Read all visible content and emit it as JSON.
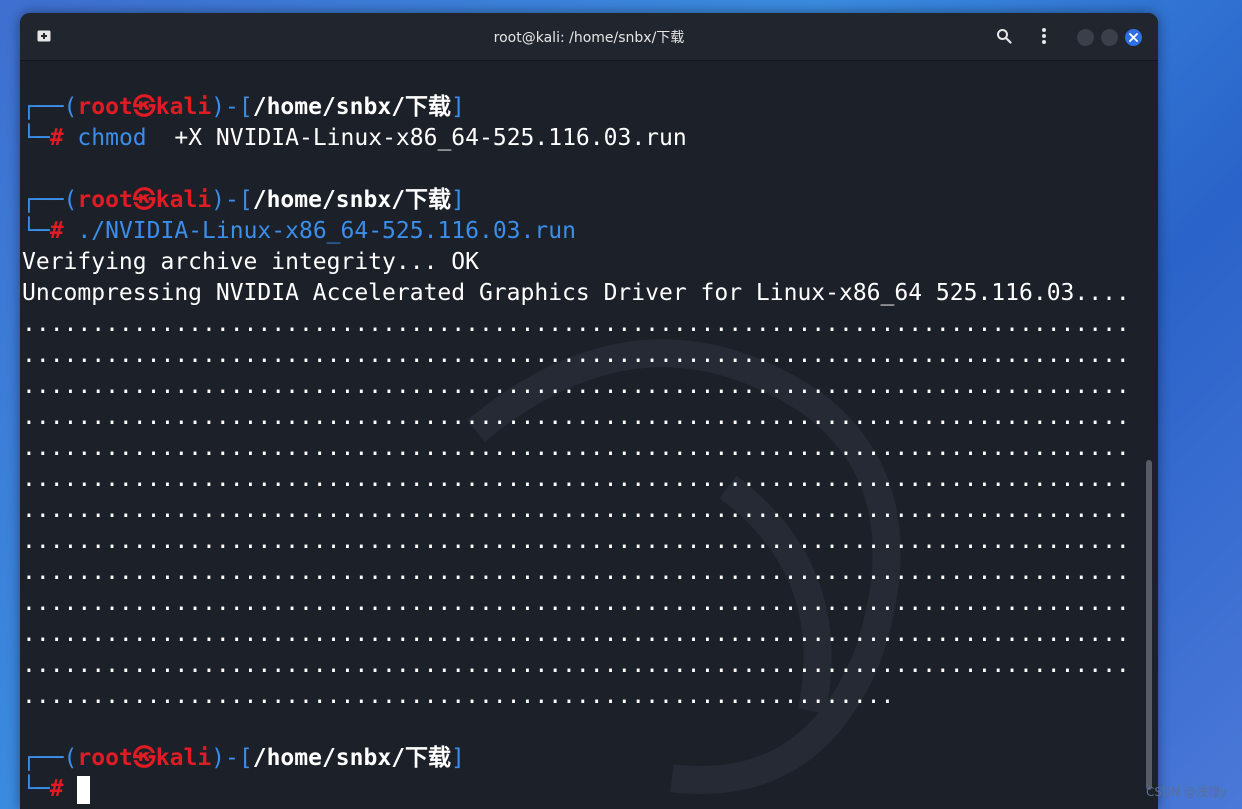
{
  "window": {
    "title": "root@kali: /home/snbx/下载"
  },
  "prompt": {
    "user": "root",
    "at_symbol": "㉿",
    "host": "kali",
    "path": "/home/snbx/下载",
    "hash": "#"
  },
  "commands": [
    {
      "cmd": "chmod",
      "args": "  +X NVIDIA-Linux-x86_64-525.116.03.run"
    },
    {
      "cmd": "./NVIDIA-Linux-x86_64-525.116.03.run",
      "args": ""
    }
  ],
  "output": [
    "Verifying archive integrity... OK",
    "Uncompressing NVIDIA Accelerated Graphics Driver for Linux-x86_64 525.116.03...."
  ],
  "progress_dots": {
    "full_lines": 12,
    "chars_per_line": 80,
    "last_line_chars": 63
  },
  "watermark": "CSDN @浅瞳y",
  "colors": {
    "blue": "#3b8eea",
    "red": "#e01b24",
    "background": "#1c2029",
    "close_button": "#2f6fe4"
  },
  "icons": [
    "new-tab-icon",
    "search-icon",
    "kebab-menu-icon",
    "close-icon"
  ]
}
